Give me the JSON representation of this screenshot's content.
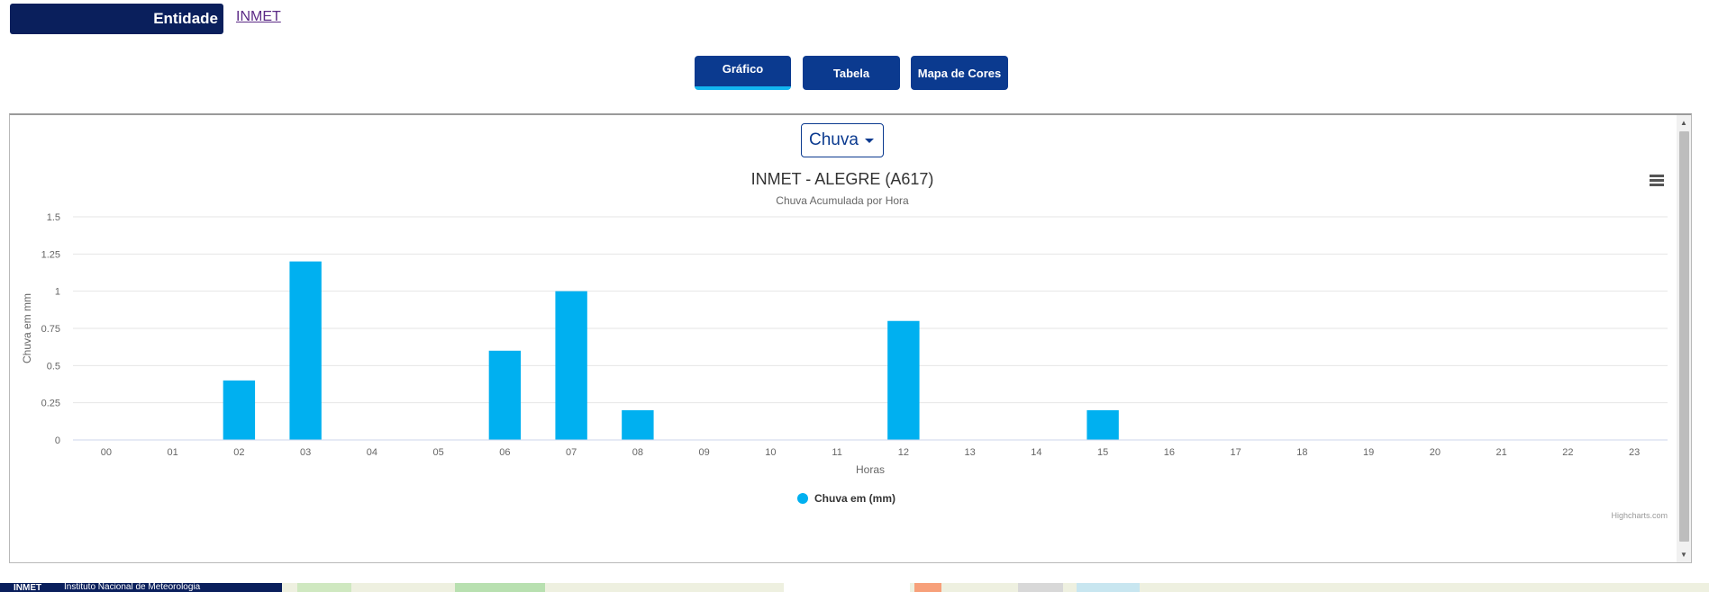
{
  "header": {
    "entity_label": "Entidade",
    "entity_link": "INMET"
  },
  "tabs": [
    {
      "label": "Gráfico",
      "active": true
    },
    {
      "label": "Tabela",
      "active": false
    },
    {
      "label": "Mapa de Cores",
      "active": false
    }
  ],
  "variable_select": {
    "value": "Chuva"
  },
  "chart_data": {
    "type": "bar",
    "title": "INMET - ALEGRE (A617)",
    "subtitle": "Chuva Acumulada por Hora",
    "xlabel": "Horas",
    "ylabel": "Chuva em mm",
    "ylim": [
      0,
      1.5
    ],
    "yticks": [
      "0",
      "0.25",
      "0.5",
      "0.75",
      "1",
      "1.25",
      "1.5"
    ],
    "categories": [
      "00",
      "01",
      "02",
      "03",
      "04",
      "05",
      "06",
      "07",
      "08",
      "09",
      "10",
      "11",
      "12",
      "13",
      "14",
      "15",
      "16",
      "17",
      "18",
      "19",
      "20",
      "21",
      "22",
      "23"
    ],
    "series": [
      {
        "name": "Chuva em (mm)",
        "color": "#00b0f0",
        "values": [
          0,
          0,
          0.4,
          1.2,
          0,
          0,
          0.6,
          1.0,
          0.2,
          0,
          0,
          0,
          0.8,
          0,
          0,
          0.2,
          0,
          0,
          0,
          0,
          0,
          0,
          0,
          0
        ]
      }
    ],
    "legend_position": "bottom-center",
    "grid": true,
    "credits": "Highcharts.com"
  },
  "footer": {
    "org_short": "INMET",
    "org_name": "Instituto Nacional de Meteorologia"
  },
  "colors": {
    "navy": "#0a1f5c",
    "button_blue": "#0b3a8f",
    "accent_cyan": "#12b5f0",
    "bar": "#00b0f0"
  }
}
